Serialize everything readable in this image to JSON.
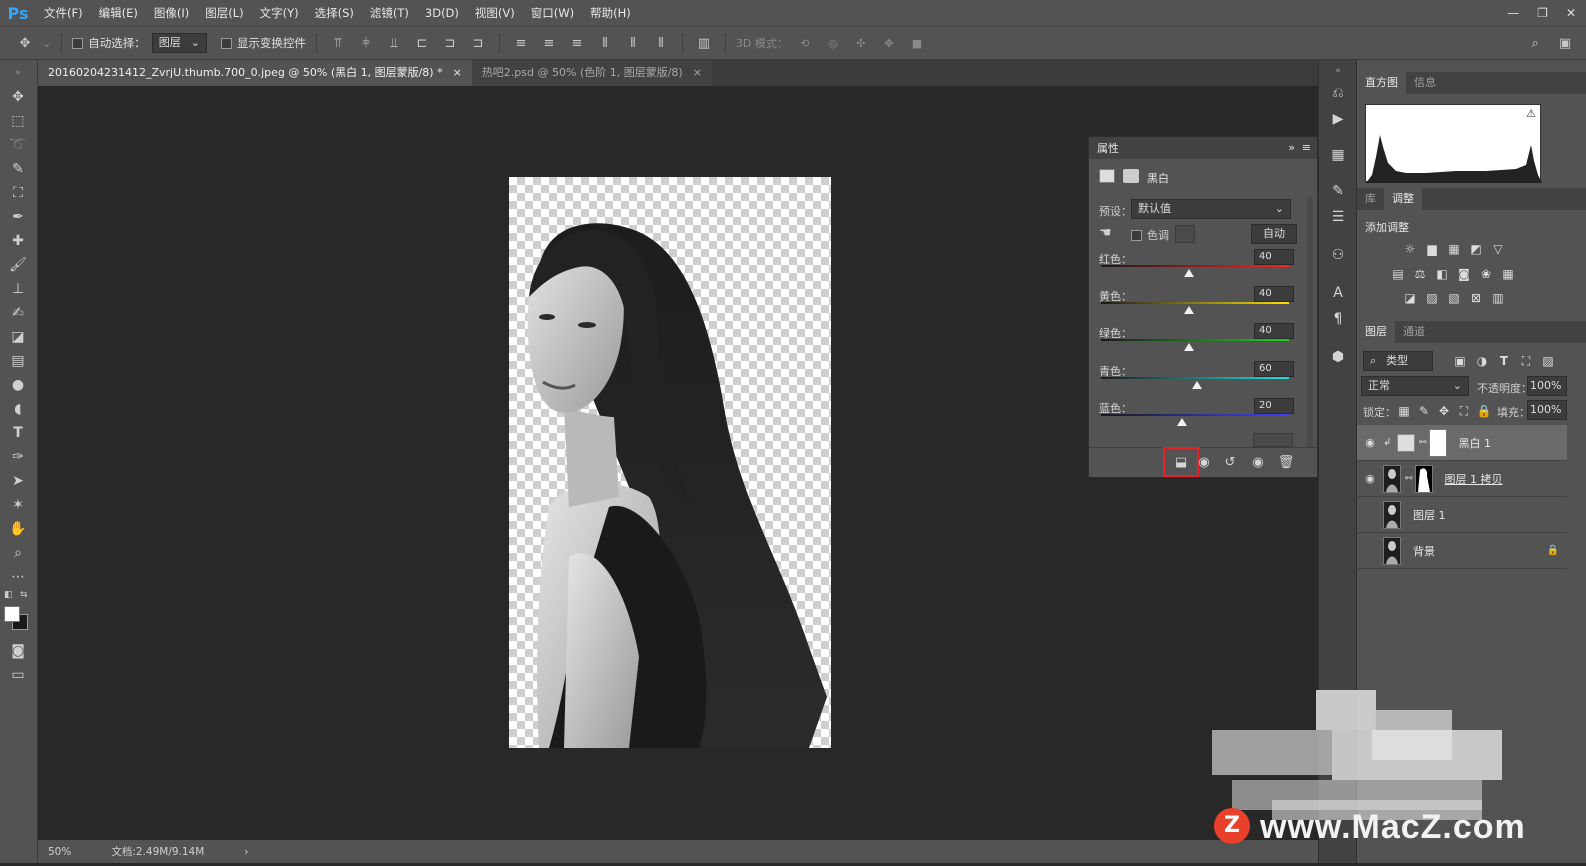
{
  "app": {
    "logo": "Ps"
  },
  "menu": [
    "文件(F)",
    "编辑(E)",
    "图像(I)",
    "图层(L)",
    "文字(Y)",
    "选择(S)",
    "滤镜(T)",
    "3D(D)",
    "视图(V)",
    "窗口(W)",
    "帮助(H)"
  ],
  "options": {
    "auto_select_label": "自动选择：",
    "auto_select_target": "图层",
    "show_transform_label": "显示变换控件",
    "mode_3d_label": "3D 模式："
  },
  "tabs": [
    {
      "label": "20160204231412_ZvrjU.thumb.700_0.jpeg @ 50% (黑白 1, 图层蒙版/8) *",
      "close": "×"
    },
    {
      "label": "热吧2.psd @ 50% (色阶 1, 图层蒙版/8)",
      "close": "×"
    }
  ],
  "status": {
    "zoom": "50%",
    "doc": "文档:2.49M/9.14M",
    "arrow": "›"
  },
  "properties": {
    "title": "属性",
    "adjust_name": "黑白",
    "preset_label": "预设：",
    "preset_value": "默认值",
    "tint_label": "色调",
    "auto_label": "自动",
    "sliders": [
      {
        "label": "红色：",
        "value": "40",
        "fraction": 0.47
      },
      {
        "label": "黄色：",
        "value": "40",
        "fraction": 0.47
      },
      {
        "label": "绿色：",
        "value": "40",
        "fraction": 0.47
      },
      {
        "label": "青色：",
        "value": "60",
        "fraction": 0.51
      },
      {
        "label": "蓝色：",
        "value": "20",
        "fraction": 0.43
      }
    ]
  },
  "panels": {
    "histogram_tab": "直方图",
    "info_tab": "信息",
    "library_tab": "库",
    "adjust_tab": "调整",
    "add_adjust": "添加调整",
    "layers_tab": "图层",
    "channels_tab": "通道",
    "filter_kind": "类型",
    "blend_mode": "正常",
    "opacity_label": "不透明度：",
    "opacity_value": "100%",
    "lock_label": "锁定：",
    "fill_label": "填充：",
    "fill_value": "100%"
  },
  "layers": [
    {
      "name": "黑白 1",
      "visible": true,
      "selected": true
    },
    {
      "name": "图层 1 拷贝",
      "visible": true,
      "selected": false
    },
    {
      "name": "图层 1",
      "visible": false,
      "selected": false
    },
    {
      "name": "背景",
      "visible": false,
      "selected": false
    }
  ],
  "watermark": {
    "text": "www.MacZ.com",
    "badge": "Z"
  }
}
